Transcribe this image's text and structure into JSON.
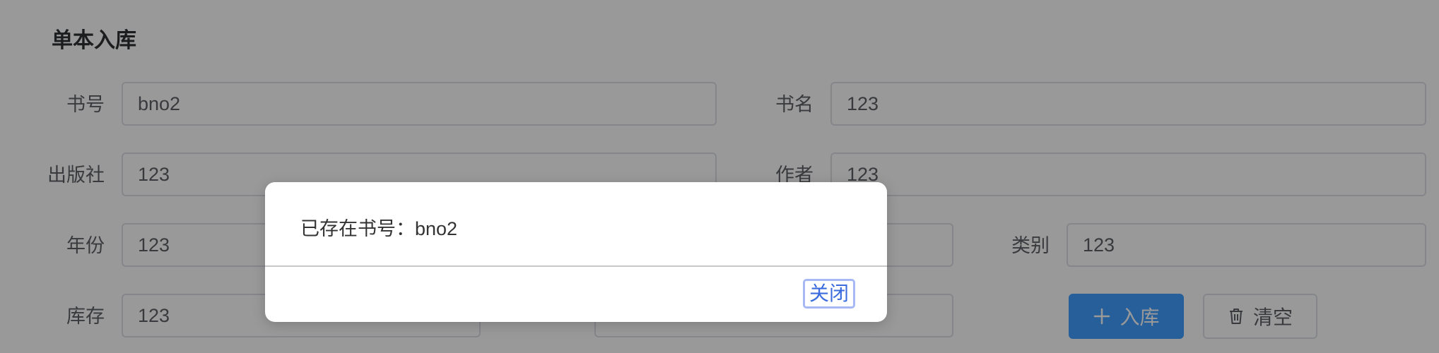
{
  "page_title": "单本入库",
  "fields": {
    "book_no": {
      "label": "书号",
      "value": "bno2"
    },
    "book_name": {
      "label": "书名",
      "value": "123"
    },
    "publisher": {
      "label": "出版社",
      "value": "123"
    },
    "author": {
      "label": "作者",
      "value": "123"
    },
    "year": {
      "label": "年份",
      "value": "123"
    },
    "hidden_mid_row3": {
      "value": ""
    },
    "category": {
      "label": "类别",
      "value": "123"
    },
    "stock": {
      "label": "库存",
      "value": "123"
    },
    "row4_mid": {
      "label": "",
      "value": ""
    }
  },
  "buttons": {
    "submit_label": "入库",
    "clear_label": "清空"
  },
  "dialog": {
    "message": "已存在书号：bno2",
    "close_label": "关闭"
  },
  "colors": {
    "primary": "#409eff",
    "overlay": "rgba(0,0,0,0.4)",
    "dialog_close_text": "#3b6cde",
    "dialog_close_border": "#a7b9f4"
  },
  "icons": {
    "submit": "plus-icon",
    "clear": "trash-icon"
  }
}
